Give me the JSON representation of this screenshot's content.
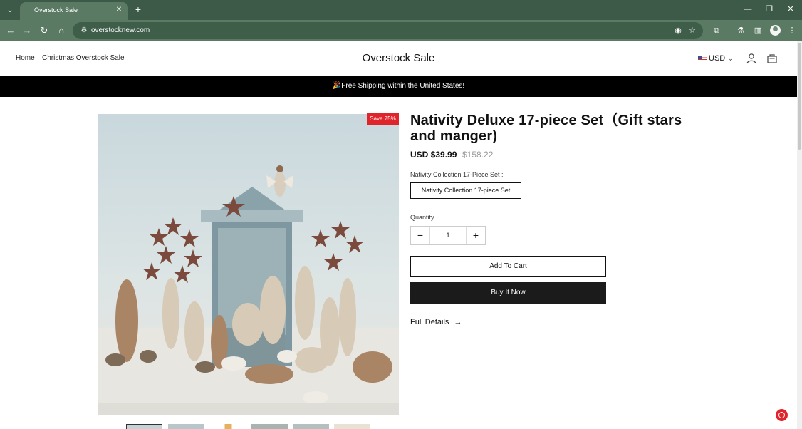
{
  "browser": {
    "tab_title": "Overstock Sale",
    "url": "overstocknew.com",
    "icons": [
      "tab-menu-icon",
      "close-icon",
      "new-tab-icon",
      "minimize-icon",
      "restore-icon",
      "window-close-icon",
      "back-icon",
      "forward-icon",
      "reload-icon",
      "home-icon",
      "site-info-icon",
      "eye-off-icon",
      "star-icon",
      "extensions-icon",
      "labs-icon",
      "side-panel-icon",
      "profile-icon",
      "kebab-menu-icon"
    ]
  },
  "header": {
    "nav": [
      "Home",
      "Christmas Overstock Sale"
    ],
    "store_title": "Overstock Sale",
    "currency": "USD"
  },
  "announcement": "🎉Free Shipping within the United States!",
  "product": {
    "badge": "Save 75%",
    "title": "Nativity Deluxe 17-piece Set（Gift stars and manger)",
    "price": "USD $39.99",
    "compare_price": "$158.22",
    "option_label": "Nativity Collection 17-Piece Set :",
    "option_value": "Nativity Collection 17-piece Set",
    "quantity_label": "Quantity",
    "quantity": "1",
    "add_to_cart": "Add To Cart",
    "buy_now": "Buy It Now",
    "full_details": "Full Details",
    "full_details_arrow": "→"
  },
  "colors": {
    "chrome_dark": "#3c5a47",
    "chrome_light": "#5b7a63",
    "badge_red": "#e0242b",
    "announcement_bg": "#000000",
    "buy_button": "#1b1b1b"
  }
}
